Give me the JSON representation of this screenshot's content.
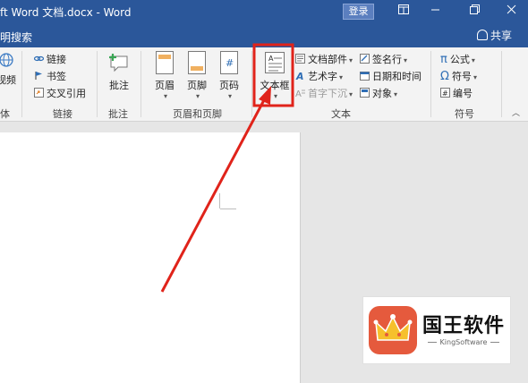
{
  "window": {
    "title": "ft Word 文档.docx  -  Word",
    "login_label": "登录",
    "share_label": "共享",
    "tell_me": "明搜索"
  },
  "ribbon": {
    "groups": {
      "media": {
        "partial_label": "视频",
        "label": "体"
      },
      "links": {
        "label": "链接",
        "items": [
          "链接",
          "书签",
          "交叉引用"
        ]
      },
      "comments": {
        "label": "批注",
        "button": "批注"
      },
      "header_footer": {
        "label": "页眉和页脚",
        "buttons": [
          "页眉",
          "页脚",
          "页码"
        ]
      },
      "text": {
        "label": "文本",
        "textbox": "文本框",
        "col1": [
          "文档部件",
          "艺术字",
          "首字下沉"
        ],
        "col2": [
          "签名行",
          "日期和时间",
          "对象"
        ]
      },
      "symbols": {
        "label": "符号",
        "items": [
          "公式",
          "符号",
          "编号"
        ]
      }
    }
  },
  "watermark": {
    "name": "国王软件",
    "sub": "KingSoftware"
  },
  "colors": {
    "titlebar": "#2b579a",
    "highlight": "#e0231a",
    "arrow": "#e0231a",
    "logo": "#e55a3d"
  }
}
